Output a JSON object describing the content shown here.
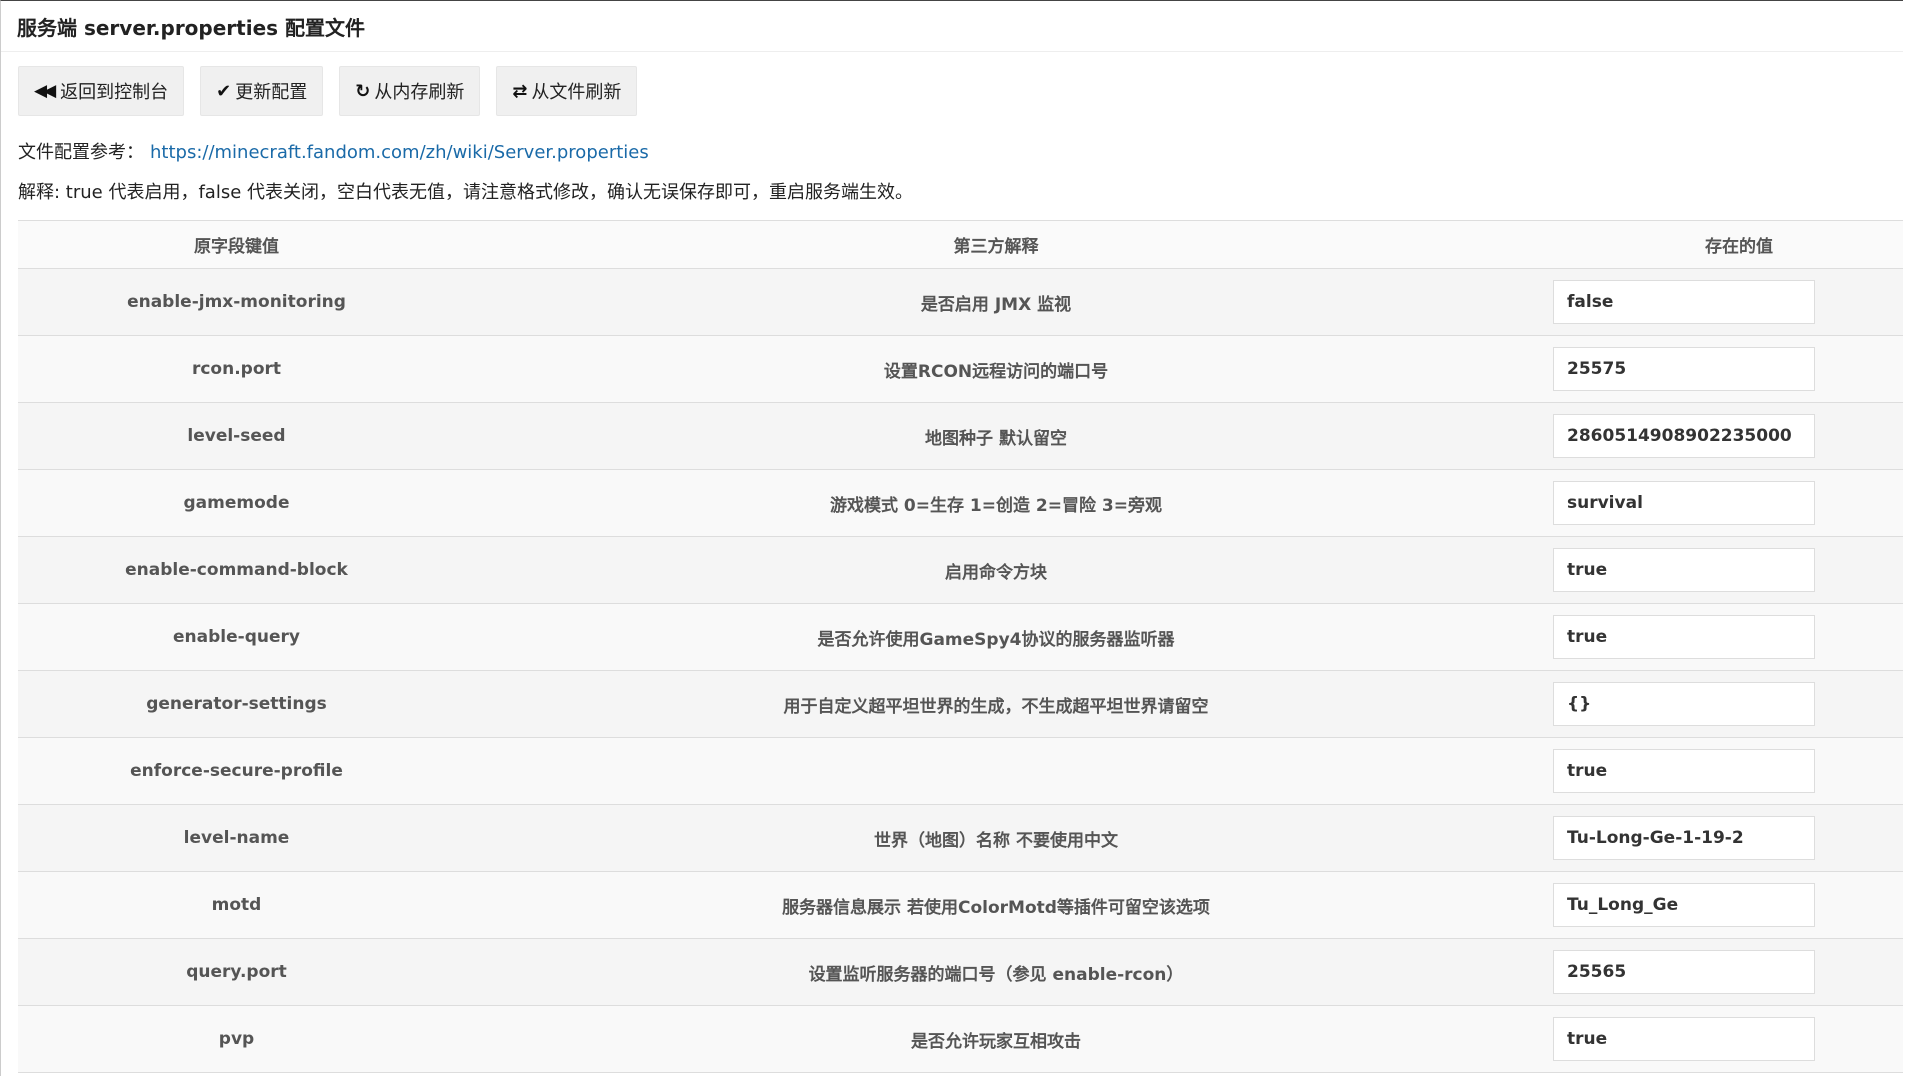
{
  "title": "服务端 server.properties 配置文件",
  "toolbar": {
    "back_label": "返回到控制台",
    "update_label": "更新配置",
    "refresh_memory_label": "从内存刷新",
    "refresh_file_label": "从文件刷新"
  },
  "reference": {
    "label": "文件配置参考：",
    "url": "https://minecraft.fandom.com/zh/wiki/Server.properties"
  },
  "note": "解释: true 代表启用，false 代表关闭，空白代表无值，请注意格式修改，确认无误保存即可，重启服务端生效。",
  "table": {
    "headers": [
      "原字段键值",
      "第三方解释",
      "存在的值"
    ],
    "rows": [
      {
        "key": "enable-jmx-monitoring",
        "desc": "是否启用 JMX 监视",
        "value": "false"
      },
      {
        "key": "rcon.port",
        "desc": "设置RCON远程访问的端口号",
        "value": "25575"
      },
      {
        "key": "level-seed",
        "desc": "地图种子 默认留空",
        "value": "2860514908902235000"
      },
      {
        "key": "gamemode",
        "desc": "游戏模式 0=生存 1=创造 2=冒险 3=旁观",
        "value": "survival"
      },
      {
        "key": "enable-command-block",
        "desc": "启用命令方块",
        "value": "true"
      },
      {
        "key": "enable-query",
        "desc": "是否允许使用GameSpy4协议的服务器监听器",
        "value": "true"
      },
      {
        "key": "generator-settings",
        "desc": "用于自定义超平坦世界的生成，不生成超平坦世界请留空",
        "value": "{}"
      },
      {
        "key": "enforce-secure-profile",
        "desc": "",
        "value": "true"
      },
      {
        "key": "level-name",
        "desc": "世界（地图）名称 不要使用中文",
        "value": "Tu-Long-Ge-1-19-2"
      },
      {
        "key": "motd",
        "desc": "服务器信息展示 若使用ColorMotd等插件可留空该选项",
        "value": "Tu_Long_Ge"
      },
      {
        "key": "query.port",
        "desc": "设置监听服务器的端口号（参见 enable-rcon）",
        "value": "25565"
      },
      {
        "key": "pvp",
        "desc": "是否允许玩家互相攻击",
        "value": "true"
      }
    ]
  }
}
